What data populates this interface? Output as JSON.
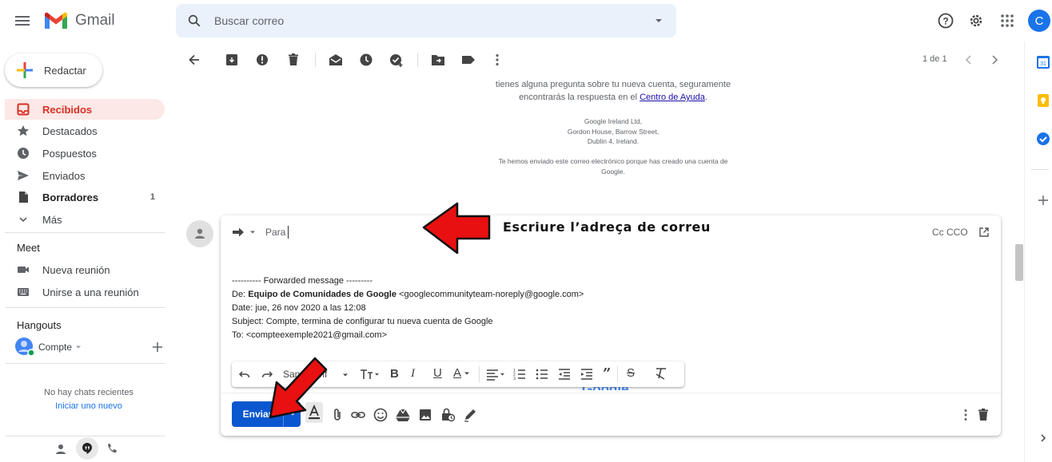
{
  "app": {
    "name": "Gmail"
  },
  "search": {
    "placeholder": "Buscar correo"
  },
  "account": {
    "initial": "C"
  },
  "sidebar": {
    "compose_label": "Redactar",
    "items": [
      {
        "label": "Recibidos",
        "count": ""
      },
      {
        "label": "Destacados",
        "count": ""
      },
      {
        "label": "Pospuestos",
        "count": ""
      },
      {
        "label": "Enviados",
        "count": ""
      },
      {
        "label": "Borradores",
        "count": "1"
      },
      {
        "label": "Más",
        "count": ""
      }
    ],
    "meet": {
      "title": "Meet",
      "items": [
        {
          "label": "Nueva reunión"
        },
        {
          "label": "Unirse a una reunión"
        }
      ]
    },
    "hangouts": {
      "title": "Hangouts",
      "user": "Compte",
      "no_chats": "No hay chats recientes",
      "start_new": "Iniciar uno nuevo"
    }
  },
  "toolbar": {
    "pager": "1 de 1"
  },
  "email_footer": {
    "line1": "tienes alguna pregunta sobre tu nueva cuenta, seguramente",
    "line2_prefix": "encontrarás la respuesta en el ",
    "line2_link": "Centro de Ayuda",
    "line2_suffix": ".",
    "address": [
      "Google Ireland Ltd,",
      "Gordon House, Barrow Street,",
      "Dublin 4, Ireland."
    ],
    "notice": [
      "Te hemos enviado este correo electrónico porque has creado una cuenta de",
      "Google."
    ]
  },
  "compose": {
    "to_label": "Para",
    "cc_label": "Cc CCO",
    "annotation": "Escriure l’adreça de correu",
    "body": {
      "forward_header": "---------- Forwarded message ---------",
      "from_prefix": "De: ",
      "from_name": "Equipo de Comunidades de Google",
      "from_email": " <googlecommunityteam-noreply@google.com>",
      "date": "Date: jue, 26 nov 2020 a las 12:08",
      "subject": "Subject: Compte, termina de configurar tu nueva cuenta de Google",
      "to": "To: <compteexemple2021@gmail.com>"
    },
    "font_name": "Sans Serif",
    "partial_logo": "Google",
    "send_label": "Enviar"
  },
  "colors": {
    "accent_blue": "#0b57d0",
    "inbox_red": "#d93025",
    "arrow_red": "#e81010",
    "link_blue": "#1a0dab"
  }
}
